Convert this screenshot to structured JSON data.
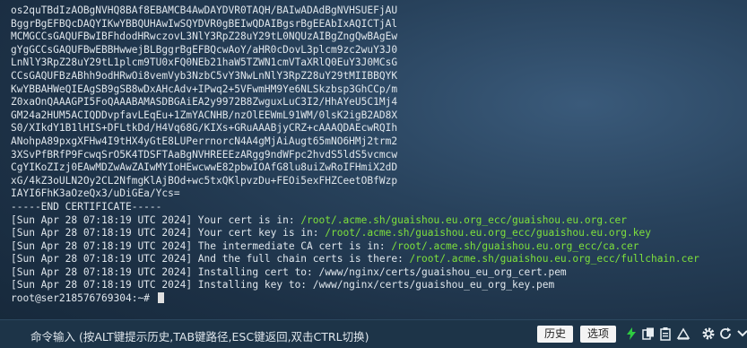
{
  "terminal": {
    "cert_lines": [
      "os2quTBdIzAOBgNVHQ8BAf8EBAMCB4AwDAYDVR0TAQH/BAIwADAdBgNVHSUEFjAU",
      "BggrBgEFBQcDAQYIKwYBBQUHAwIwSQYDVR0gBEIwQDAIBgsrBgEEAbIxAQICTjAl",
      "MCMGCCsGAQUFBwIBFhdodHRwczovL3NlY3RpZ28uY29tL0NQUzAIBgZngQwBAgEw",
      "gYgGCCsGAQUFBwEBBHwwejBLBggrBgEFBQcwAoY/aHR0cDovL3plcm9zc2wuY3J0",
      "LnNlY3RpZ28uY29tL1plcm9TU0xFQ0NEb21haW5TZWN1cmVTaXRlQ0EuY3J0MCsG",
      "CCsGAQUFBzABhh9odHRwOi8vemVyb3NzbC5vY3NwLnNlY3RpZ28uY29tMIIBBQYK",
      "KwYBBAHWeQIEAgSB9gSB8wDxAHcAdv+IPwq2+5VFwmHM9Ye6NLSkzbsp3GhCCp/m",
      "Z0xaOnQAAAGPI5FoQAAABAMASDBGAiEA2y9972B8ZwguxLuC3I2/HhAYeU5C1Mj4",
      "GM24a2HUM5ACIQDDvpfavLEqEu+1ZmYACNHB/nzOlEEWmL91WM/0lsK2igB2AD8X",
      "S0/XIkdY1B1lHIS+DFLtkDd/H4Vq68G/KIXs+GRuAAABjyCRZ+cAAAQDAEcwRQIh",
      "ANohpA89pxgXFHw4I9tHX4yGtE8LUPerrnorcN4A4gMjAiAugt65mNO6HMj2trm2",
      "3XSvPfBRfP9FcwqSrO5K4TDSFTAaBgNVHREEEzARgg9ndWFpc2hvdS5ldS5vcmcw",
      "CgYIKoZIzj0EAwMDZwAwZAIwMYIoHEwcwwE82pbwIOAfG8lu8uiZwRoIFHmiX2dD",
      "xG/4kZ3oULN2Oy2CL2NfmgKlAjBOd+wc5txQKlpvzDu+FEOi5exFHZCeetOBfWzp",
      "IAYI6FhK3aOzeQx3/uDiGEa/Ycs=",
      "-----END CERTIFICATE-----"
    ],
    "log_lines": [
      {
        "prefix": "[Sun Apr 28 07:18:19 UTC 2024] Your cert is in: ",
        "path": "/root/.acme.sh/guaishou.eu.org_ecc/guaishou.eu.org.cer"
      },
      {
        "prefix": "[Sun Apr 28 07:18:19 UTC 2024] Your cert key is in: ",
        "path": "/root/.acme.sh/guaishou.eu.org_ecc/guaishou.eu.org.key"
      },
      {
        "prefix": "[Sun Apr 28 07:18:19 UTC 2024] The intermediate CA cert is in: ",
        "path": "/root/.acme.sh/guaishou.eu.org_ecc/ca.cer"
      },
      {
        "prefix": "[Sun Apr 28 07:18:19 UTC 2024] And the full chain certs is there: ",
        "path": "/root/.acme.sh/guaishou.eu.org_ecc/fullchain.cer"
      },
      {
        "prefix": "[Sun Apr 28 07:18:19 UTC 2024] Installing cert to: /www/nginx/certs/guaishou_eu_org_cert.pem",
        "path": ""
      },
      {
        "prefix": "[Sun Apr 28 07:18:19 UTC 2024] Installing key to: /www/nginx/certs/guaishou_eu_org_key.pem",
        "path": ""
      }
    ],
    "prompt": "root@ser218576769304:~# "
  },
  "command_bar": {
    "input_hint": "命令输入 (按ALT键提示历史,TAB键路径,ESC键返回,双击CTRL切换)",
    "history_button": "历史",
    "options_button": "选项",
    "icons": [
      "lightning-icon",
      "copy-icon",
      "paste-icon",
      "clear-icon",
      "settings-icon",
      "refresh-icon",
      "more-icon"
    ]
  },
  "colors": {
    "path_green": "#7ee03c",
    "text": "#dfe6ec",
    "lightning_green": "#2ecc40"
  }
}
